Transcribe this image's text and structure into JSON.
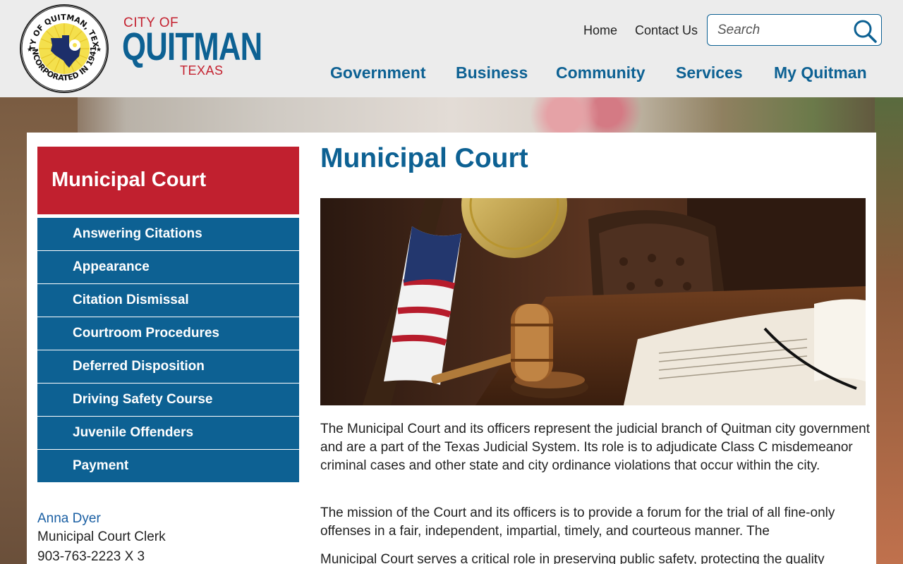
{
  "logo": {
    "seal_top_text": "CITY OF QUITMAN, TEXAS",
    "seal_bottom_text": "INCORPORATED IN 1941",
    "city_of": "CITY OF",
    "name": "QUITMAN",
    "state": "TEXAS"
  },
  "utility_nav": {
    "home": "Home",
    "contact": "Contact Us"
  },
  "search": {
    "placeholder": "Search"
  },
  "main_nav": [
    "Government",
    "Business",
    "Community",
    "Services",
    "My Quitman"
  ],
  "sidebar": {
    "title": "Municipal Court",
    "items": [
      "Answering Citations",
      "Appearance",
      "Citation Dismissal",
      "Courtroom Procedures",
      "Deferred Disposition",
      "Driving Safety Course",
      "Juvenile Offenders",
      "Payment"
    ]
  },
  "contact": {
    "name": "Anna Dyer",
    "title": "Municipal Court Clerk",
    "phone": "903-763-2223 X 3"
  },
  "main": {
    "title": "Municipal Court",
    "paragraphs": [
      "The Municipal Court and its officers represent the judicial branch of Quitman city government and are a part of the Texas Judicial System. Its role is to adjudicate Class C misdemeanor criminal cases and other state and city ordinance violations that occur within the city.",
      "The mission of the Court and its officers is to provide a forum for the trial of all fine-only offenses in a fair, independent, impartial, timely, and courteous manner. The",
      "Municipal Court serves a critical role in preserving public safety, protecting the quality"
    ]
  },
  "colors": {
    "brand_blue": "#0d6193",
    "brand_red": "#c1202f",
    "header_bg": "#ececec"
  }
}
